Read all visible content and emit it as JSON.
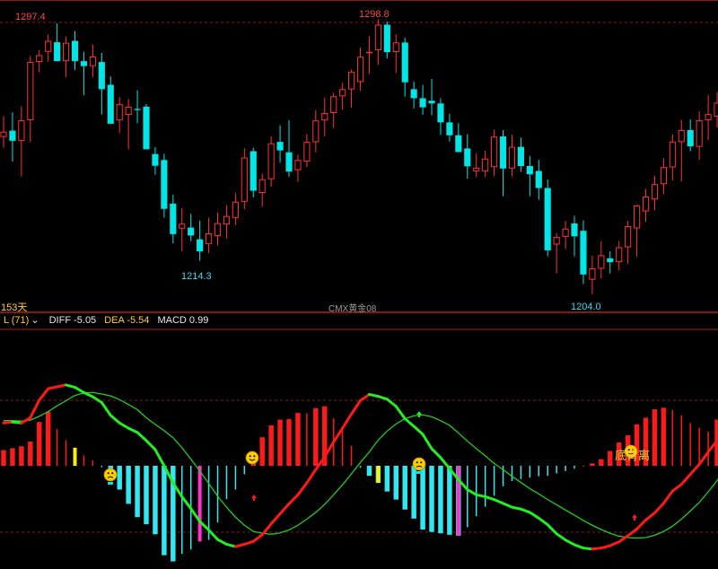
{
  "colors": {
    "up": "#ff3232",
    "down": "#00e6e6",
    "grid": "#8a1a1a",
    "diff_up": "#ff1a1a",
    "diff_down": "#22ee22",
    "dea": "#22cc22",
    "hist_pos": "#ff1a1a",
    "hist_neg": "#33e6f0",
    "signal_yellow": "#ffee00",
    "signal_magenta": "#ff33cc",
    "label_high": "#ff4444",
    "label_low": "#33ddee",
    "text_white": "#e6e6e6",
    "text_yellow": "#ffcc33",
    "text_gray": "#9a9a9a"
  },
  "price_panel": {
    "period_label": "153天",
    "symbol_label": "CMX黄金08",
    "marks": {
      "high1": "1297.4",
      "high2": "1298.8",
      "low1": "1214.3",
      "low2": "1204.0"
    }
  },
  "macd_panel": {
    "selector": "L (71)",
    "selector_icon": "chevron-down-icon",
    "diff_label": "DIFF -5.05",
    "dea_label": "DEA -5.54",
    "macd_label": "MACD 0.99",
    "divergence_label": "底背离",
    "smiley_icon": "smiley-face-icon",
    "arrow_icon": "up-arrow-icon"
  },
  "chart_data": {
    "type": "candlestick+macd",
    "price": {
      "ohlc": [
        [
          1256.0,
          1263.5,
          1252.1,
          1257.9
        ],
        [
          1258.3,
          1265.0,
          1247.0,
          1254.6
        ],
        [
          1254.6,
          1267.1,
          1241.6,
          1262.1
        ],
        [
          1262.1,
          1285.5,
          1254.1,
          1283.3
        ],
        [
          1283.3,
          1287.7,
          1279.5,
          1285.8
        ],
        [
          1287.0,
          1293.3,
          1283.4,
          1291.0
        ],
        [
          1290.5,
          1297.4,
          1285.7,
          1283.6
        ],
        [
          1283.6,
          1292.6,
          1277.8,
          1290.3
        ],
        [
          1291.0,
          1294.6,
          1280.4,
          1283.6
        ],
        [
          1283.6,
          1287.0,
          1271.2,
          1281.8
        ],
        [
          1281.8,
          1289.7,
          1277.8,
          1285.3
        ],
        [
          1283.3,
          1286.6,
          1264.2,
          1273.4
        ],
        [
          1275.0,
          1278.1,
          1262.4,
          1260.8
        ],
        [
          1262.0,
          1270.5,
          1257.4,
          1268.0
        ],
        [
          1264.0,
          1269.8,
          1251.5,
          1267.0
        ],
        [
          1266.2,
          1273.0,
          1261.0,
          1265.8
        ],
        [
          1267.0,
          1268.0,
          1257.4,
          1251.5
        ],
        [
          1249.8,
          1252.3,
          1242.2,
          1245.5
        ],
        [
          1247.6,
          1249.9,
          1226.6,
          1229.8
        ],
        [
          1231.7,
          1235.0,
          1217.2,
          1220.6
        ],
        [
          1222.6,
          1230.1,
          1214.3,
          1224.4
        ],
        [
          1223.0,
          1228.0,
          1218.0,
          1220.1
        ],
        [
          1218.7,
          1225.5,
          1210.9,
          1214.3
        ],
        [
          1216.9,
          1226.6,
          1213.7,
          1220.9
        ],
        [
          1219.9,
          1228.4,
          1216.5,
          1224.6
        ],
        [
          1224.1,
          1231.2,
          1219.0,
          1227.2
        ],
        [
          1226.5,
          1235.6,
          1223.9,
          1232.4
        ],
        [
          1232.4,
          1251.9,
          1229.7,
          1248.5
        ],
        [
          1250.8,
          1252.1,
          1234.0,
          1236.4
        ],
        [
          1235.6,
          1242.6,
          1230.5,
          1240.6
        ],
        [
          1240.6,
          1256.3,
          1237.9,
          1253.7
        ],
        [
          1254.2,
          1260.3,
          1246.7,
          1251.1
        ],
        [
          1250.4,
          1262.1,
          1241.5,
          1243.4
        ],
        [
          1243.9,
          1249.5,
          1239.6,
          1247.6
        ],
        [
          1247.0,
          1257.1,
          1245.0,
          1254.2
        ],
        [
          1254.1,
          1265.7,
          1250.4,
          1262.0
        ],
        [
          1262.0,
          1270.3,
          1256.3,
          1264.7
        ],
        [
          1264.7,
          1272.1,
          1259.2,
          1270.8
        ],
        [
          1270.8,
          1275.7,
          1265.9,
          1273.4
        ],
        [
          1273.3,
          1280.6,
          1266.7,
          1279.8
        ],
        [
          1276.0,
          1288.6,
          1272.8,
          1285.2
        ],
        [
          1286.5,
          1292.7,
          1278.9,
          1287.0
        ],
        [
          1287.6,
          1298.8,
          1282.2,
          1296.9
        ],
        [
          1296.9,
          1298.1,
          1284.6,
          1286.9
        ],
        [
          1286.9,
          1293.4,
          1279.3,
          1290.4
        ],
        [
          1290.4,
          1292.1,
          1270.7,
          1275.9
        ],
        [
          1273.4,
          1276.2,
          1266.4,
          1270.1
        ],
        [
          1270.1,
          1275.0,
          1264.1,
          1266.8
        ],
        [
          1269.2,
          1277.1,
          1263.9,
          1268.2
        ],
        [
          1268.2,
          1270.1,
          1256.8,
          1261.3
        ],
        [
          1261.3,
          1264.4,
          1254.3,
          1256.6
        ],
        [
          1256.6,
          1261.0,
          1252.2,
          1250.5
        ],
        [
          1251.8,
          1257.0,
          1240.8,
          1245.3
        ],
        [
          1243.5,
          1250.1,
          1241.4,
          1244.8
        ],
        [
          1243.5,
          1251.1,
          1241.4,
          1248.1
        ],
        [
          1245.0,
          1258.6,
          1241.7,
          1256.1
        ],
        [
          1256.2,
          1258.5,
          1234.4,
          1244.5
        ],
        [
          1244.5,
          1256.8,
          1241.6,
          1252.4
        ],
        [
          1252.4,
          1255.8,
          1243.3,
          1245.4
        ],
        [
          1245.4,
          1249.1,
          1234.4,
          1242.4
        ],
        [
          1243.6,
          1247.7,
          1233.1,
          1237.4
        ],
        [
          1237.4,
          1240.5,
          1212.5,
          1214.7
        ],
        [
          1216.8,
          1221.0,
          1206.3,
          1219.6
        ],
        [
          1219.6,
          1225.4,
          1215.3,
          1222.6
        ],
        [
          1224.5,
          1227.3,
          1212.5,
          1219.8
        ],
        [
          1221.8,
          1225.6,
          1202.4,
          1205.9
        ],
        [
          1204.0,
          1212.7,
          1198.7,
          1208.1
        ],
        [
          1208.0,
          1218.0,
          1204.4,
          1212.9
        ],
        [
          1211.8,
          1214.4,
          1206.2,
          1210.4
        ],
        [
          1210.4,
          1218.0,
          1207.4,
          1215.8
        ],
        [
          1215.8,
          1225.4,
          1209.7,
          1223.5
        ],
        [
          1222.7,
          1231.2,
          1212.4,
          1231.0
        ],
        [
          1228.9,
          1237.1,
          1225.1,
          1234.3
        ],
        [
          1233.2,
          1241.9,
          1229.3,
          1238.8
        ],
        [
          1238.8,
          1248.2,
          1235.1,
          1245.0
        ],
        [
          1244.9,
          1256.9,
          1240.2,
          1254.3
        ],
        [
          1254.1,
          1262.2,
          1239.8,
          1258.5
        ],
        [
          1258.5,
          1262.4,
          1250.8,
          1252.6
        ],
        [
          1252.4,
          1265.3,
          1247.7,
          1262.1
        ],
        [
          1262.1,
          1271.2,
          1254.9,
          1264.3
        ],
        [
          1263.4,
          1272.3,
          1259.4,
          1268.5
        ]
      ]
    },
    "macd": {
      "diff": [
        9.0,
        9.2,
        9.0,
        10.1,
        13.8,
        16.2,
        16.6,
        17.0,
        16.5,
        15.4,
        14.5,
        13.3,
        10.6,
        9.0,
        7.9,
        7.0,
        5.3,
        3.4,
        0.0,
        -3.6,
        -6.5,
        -9.0,
        -11.7,
        -13.5,
        -15.5,
        -16.5,
        -17.0,
        -16.5,
        -15.9,
        -14.5,
        -12.2,
        -10.1,
        -8.0,
        -6.1,
        -3.6,
        -0.8,
        1.9,
        5.0,
        7.9,
        10.9,
        13.7,
        15.0,
        14.6,
        14.0,
        12.5,
        9.9,
        8.3,
        6.6,
        3.6,
        1.7,
        -0.6,
        -2.9,
        -5.0,
        -6.1,
        -6.5,
        -7.1,
        -7.9,
        -8.7,
        -9.1,
        -9.8,
        -11.0,
        -12.4,
        -14.3,
        -15.6,
        -16.6,
        -17.3,
        -17.5,
        -17.3,
        -16.8,
        -16.0,
        -14.7,
        -13.3,
        -11.4,
        -9.9,
        -7.9,
        -5.3,
        -3.9,
        -1.8,
        0.3,
        2.9,
        5.3,
        7.8
      ],
      "dea": [
        9.5,
        9.5,
        9.4,
        9.6,
        10.4,
        11.4,
        12.6,
        13.7,
        14.8,
        15.3,
        15.4,
        15.1,
        14.7,
        13.9,
        12.9,
        11.8,
        10.1,
        8.7,
        7.4,
        5.9,
        3.8,
        1.4,
        -1.1,
        -3.7,
        -6.4,
        -8.7,
        -10.8,
        -12.5,
        -13.8,
        -14.2,
        -14.4,
        -14.1,
        -13.5,
        -12.5,
        -11.2,
        -9.8,
        -8.1,
        -6.1,
        -4.0,
        -1.7,
        0.7,
        2.9,
        5.4,
        7.3,
        8.8,
        9.9,
        10.5,
        10.7,
        10.3,
        9.5,
        8.5,
        6.9,
        5.2,
        3.6,
        2.1,
        0.5,
        -0.8,
        -2.2,
        -3.5,
        -4.8,
        -5.9,
        -7.1,
        -8.2,
        -9.3,
        -10.4,
        -11.5,
        -12.5,
        -13.4,
        -14.2,
        -14.8,
        -15.1,
        -15.2,
        -15.1,
        -14.6,
        -13.8,
        -12.7,
        -11.2,
        -9.5,
        -7.7,
        -5.5,
        -3.1,
        -0.8
      ],
      "hist": [
        3.3,
        3.7,
        4.1,
        5.1,
        9.2,
        11.4,
        7.7,
        5.3,
        3.8,
        2.2,
        1.1,
        -0.3,
        -2.8,
        -5.0,
        -8.0,
        -10.8,
        -12.3,
        -14.4,
        -18.8,
        -20.1,
        -18.5,
        -17.6,
        -15.9,
        -15.6,
        -11.9,
        -7.0,
        -5.0,
        -1.8,
        2.7,
        6.0,
        8.5,
        9.7,
        9.8,
        11.1,
        11.0,
        12.1,
        12.5,
        10.0,
        7.6,
        4.2,
        -0.4,
        -2.1,
        -3.6,
        -5.4,
        -7.1,
        -9.2,
        -11.1,
        -13.4,
        -13.9,
        -14.2,
        -14.5,
        -14.7,
        -12.9,
        -10.6,
        -8.6,
        -6.3,
        -4.3,
        -3.2,
        -2.8,
        -2.5,
        -2.2,
        -2.1,
        -1.6,
        -1.1,
        -0.6,
        0.0,
        0.5,
        1.4,
        3.1,
        4.9,
        6.4,
        8.7,
        10.1,
        11.9,
        12.2,
        11.7,
        10.6,
        9.0,
        8.0,
        7.2,
        9.7,
        10.5
      ]
    }
  }
}
